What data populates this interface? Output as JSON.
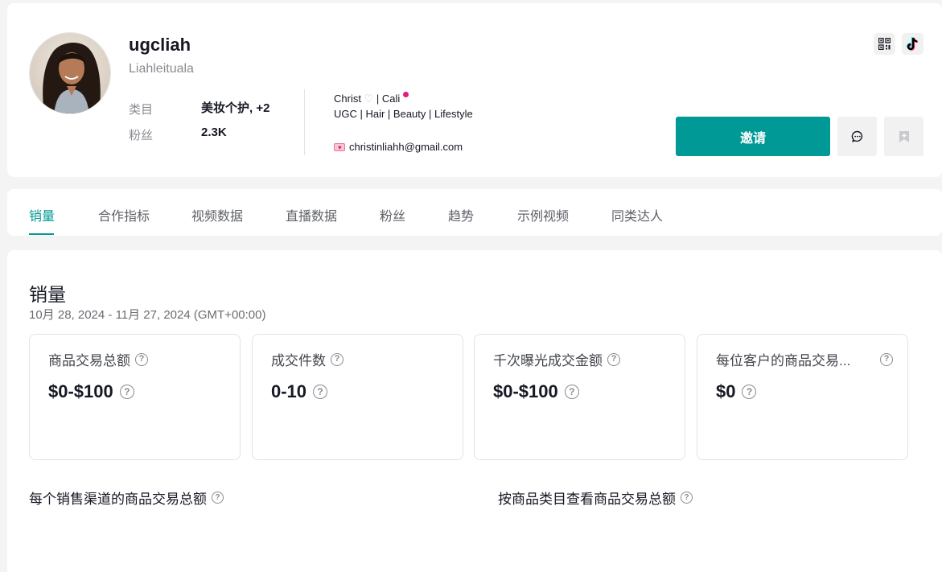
{
  "profile": {
    "username": "ugcliah",
    "nickname": "Liahleituala",
    "category_label": "类目",
    "category_value": "美妆个护, +2",
    "followers_label": "粉丝",
    "followers_value": "2.3K",
    "bio_line1_a": "Christ",
    "bio_line1_b": "| Cali",
    "bio_line2": "UGC | Hair | Beauty | Lifestyle",
    "bio_email": "christinliahh@gmail.com",
    "heart_icon": "white-heart",
    "pin_icon": "pin-emoji",
    "email_icon": "heart-letter-emoji"
  },
  "actions": {
    "invite_label": "邀请",
    "qr_icon": "qr-code-icon",
    "tiktok_icon": "tiktok-logo-icon",
    "message_icon": "chat-bubble-icon",
    "save_icon": "bookmark-plus-icon"
  },
  "tabs": [
    {
      "label": "销量",
      "active": true
    },
    {
      "label": "合作指标"
    },
    {
      "label": "视频数据"
    },
    {
      "label": "直播数据"
    },
    {
      "label": "粉丝"
    },
    {
      "label": "趋势"
    },
    {
      "label": "示例视频"
    },
    {
      "label": "同类达人"
    }
  ],
  "sales": {
    "title": "销量",
    "date_range": "10月 28, 2024 - 11月 27, 2024 (GMT+00:00)",
    "metrics": [
      {
        "label": "商品交易总额",
        "value": "$0-$100"
      },
      {
        "label": "成交件数",
        "value": "0-10"
      },
      {
        "label": "千次曝光成交金额",
        "value": "$0-$100"
      },
      {
        "label": "每位客户的商品交易...",
        "value": "$0"
      }
    ],
    "channel_title": "每个销售渠道的商品交易总额",
    "category_title": "按商品类目查看商品交易总额"
  },
  "colors": {
    "accent": "#009995",
    "background": "#f4f4f4",
    "text": "#161823",
    "muted": "#8a8b91"
  }
}
